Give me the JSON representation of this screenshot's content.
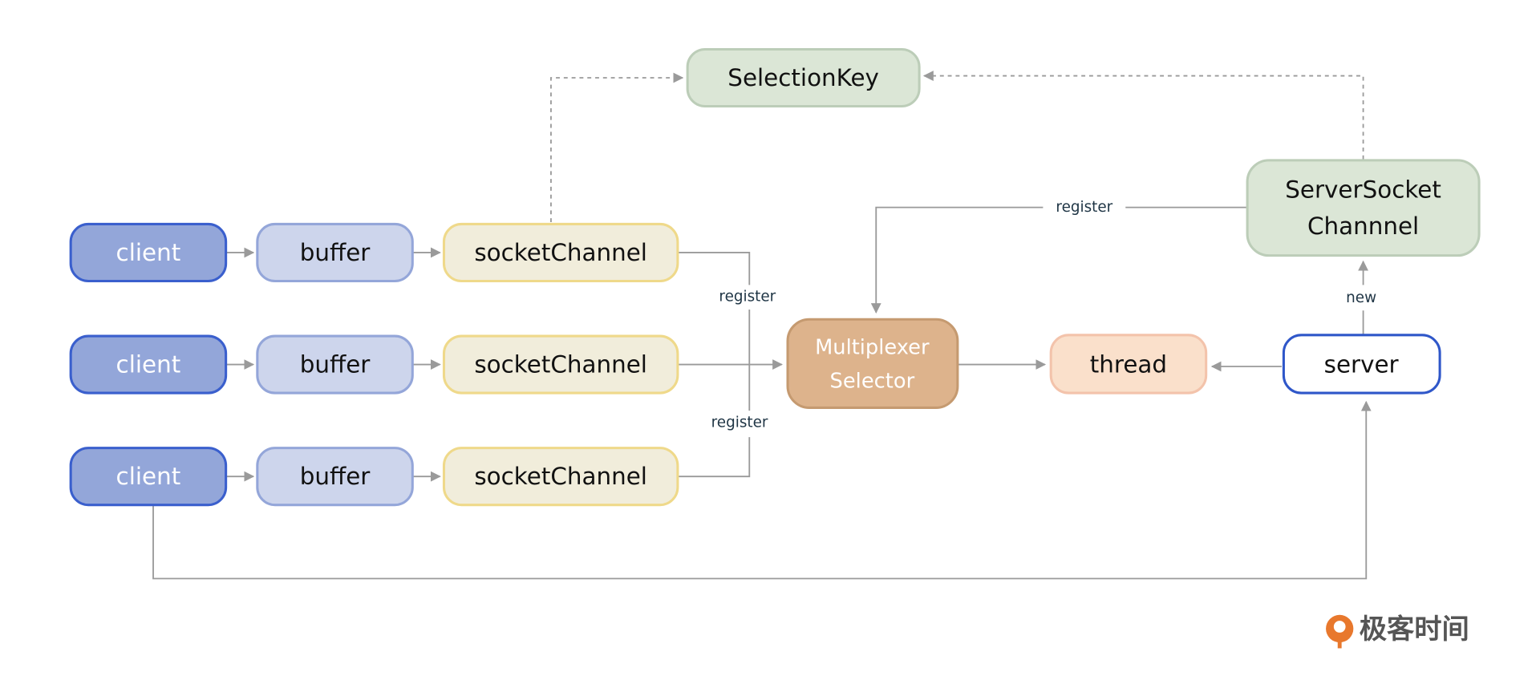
{
  "nodes": {
    "client": "client",
    "buffer": "buffer",
    "socket_channel": "socketChannel",
    "selection_key": "SelectionKey",
    "server_socket_channel": [
      "ServerSocket",
      "Channnel"
    ],
    "multiplexer": [
      "Multiplexer",
      "Selector"
    ],
    "thread": "thread",
    "server": "server"
  },
  "edge_labels": {
    "register": "register",
    "new": "new"
  },
  "logo": "极客时间",
  "colors": {
    "client_fill": "#93a6d9",
    "client_border": "#3a5fcd",
    "buffer_fill": "#cdd5ec",
    "buffer_border": "#94a6d9",
    "socket_fill": "#f1eddb",
    "socket_border": "#efd98a",
    "green_fill": "#dbe6d6",
    "green_border": "#bccdb8",
    "multiplexer_fill": "#ddb38c",
    "multiplexer_border": "#c59a70",
    "thread_fill": "#fae0cb",
    "thread_border": "#f3c3ab",
    "server_fill": "#ffffff",
    "server_border": "#2f57c9",
    "logo": "#e8782d"
  }
}
